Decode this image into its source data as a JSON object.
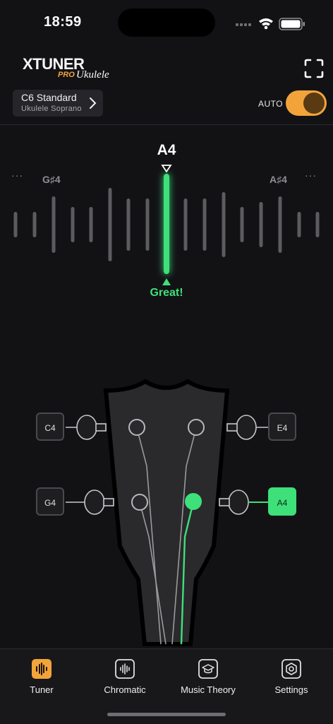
{
  "status_bar": {
    "time": "18:59"
  },
  "header": {
    "logo": {
      "brand": "XTUNER",
      "sub": "PRO",
      "script": "Ukulele"
    },
    "tuning": {
      "name": "C6 Standard",
      "instrument": "Ukulele Soprano"
    },
    "auto_label": "AUTO",
    "auto_on": true
  },
  "meter": {
    "target_note": "A4",
    "left_note": "G♯4",
    "right_note": "A♯4",
    "left_more": "···",
    "right_more": "···",
    "status": "Great!",
    "cents_offset": 0
  },
  "strings": [
    {
      "label": "C4",
      "side": "left",
      "row": 1,
      "active": false
    },
    {
      "label": "G4",
      "side": "left",
      "row": 2,
      "active": false
    },
    {
      "label": "E4",
      "side": "right",
      "row": 1,
      "active": false
    },
    {
      "label": "A4",
      "side": "right",
      "row": 2,
      "active": true
    }
  ],
  "tabs": [
    {
      "label": "Tuner",
      "icon": "tuner-icon",
      "active": true
    },
    {
      "label": "Chromatic",
      "icon": "chromatic-icon",
      "active": false
    },
    {
      "label": "Music Theory",
      "icon": "music-theory-icon",
      "active": false
    },
    {
      "label": "Settings",
      "icon": "settings-icon",
      "active": false
    }
  ],
  "colors": {
    "accent": "#f2a43a",
    "in_tune": "#3ee07a",
    "background": "#121215"
  }
}
